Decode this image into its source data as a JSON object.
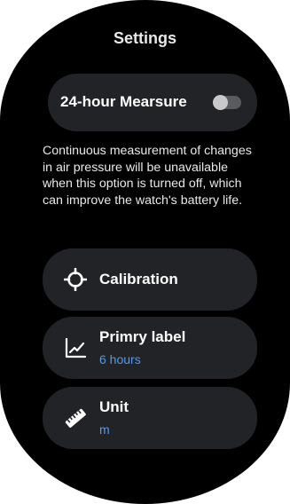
{
  "header": {
    "title": "Settings"
  },
  "toggle": {
    "label": "24-hour Mearsure",
    "on": false
  },
  "description": "Continuous measurement of changes in air pressure will be unavailable when this option is turned off, which can improve the watch's battery life.",
  "menu": [
    {
      "label": "Calibration",
      "icon": "crosshair-icon"
    },
    {
      "label": "Primry label",
      "value": "6 hours",
      "icon": "chart-line-icon"
    },
    {
      "label": "Unit",
      "value": "m",
      "icon": "ruler-icon"
    }
  ],
  "colors": {
    "background": "#000000",
    "card": "#222326",
    "accent": "#4d9bf5",
    "switch_track": "#5a5b5e"
  }
}
